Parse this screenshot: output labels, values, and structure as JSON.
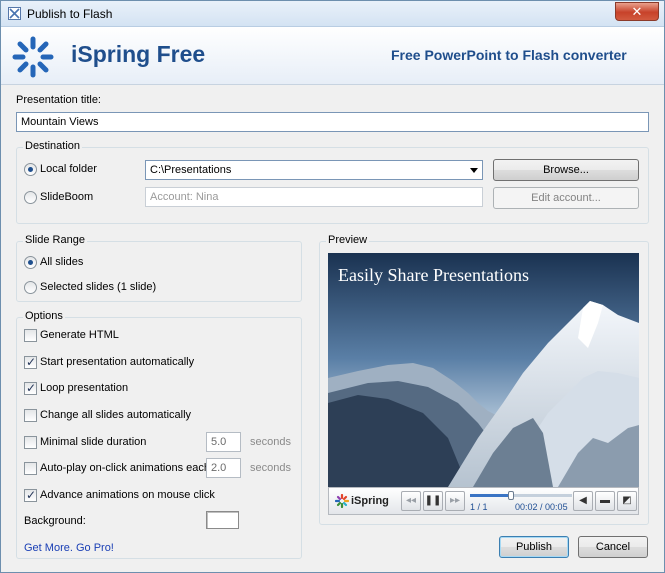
{
  "window": {
    "title": "Publish to Flash"
  },
  "banner": {
    "brand": "iSpring Free",
    "tagline": "Free PowerPoint to Flash converter"
  },
  "presentation": {
    "title_label": "Presentation title:",
    "title_value": "Mountain Views"
  },
  "destination": {
    "group_label": "Destination",
    "local_folder_label": "Local folder",
    "local_folder_value": "C:\\Presentations",
    "browse_label": "Browse...",
    "slideboom_label": "SlideBoom",
    "account_placeholder": "Account: Nina",
    "edit_account_label": "Edit account..."
  },
  "slide_range": {
    "group_label": "Slide Range",
    "all_slides_label": "All slides",
    "selected_slides_label": "Selected slides (1 slide)"
  },
  "options": {
    "group_label": "Options",
    "generate_html": {
      "label": "Generate HTML",
      "checked": false
    },
    "start_auto": {
      "label": "Start presentation automatically",
      "checked": true
    },
    "loop": {
      "label": "Loop presentation",
      "checked": true
    },
    "change_all": {
      "label": "Change all slides automatically",
      "checked": false
    },
    "min_duration": {
      "label": "Minimal slide duration",
      "value": "5.0",
      "units": "seconds",
      "checked": false
    },
    "autoplay": {
      "label": "Auto-play on-click animations each",
      "value": "2.0",
      "units": "seconds",
      "checked": false
    },
    "advance": {
      "label": "Advance animations on mouse click",
      "checked": true
    },
    "background_label": "Background:",
    "pro_link": "Get More. Go Pro!"
  },
  "preview": {
    "group_label": "Preview",
    "slide_title": "Easily Share Presentations",
    "player_brand": "iSpring",
    "slide_counter": "1 / 1",
    "time_current": "00:02",
    "time_separator": " / ",
    "time_total": "00:05",
    "progress_fraction": 0.4
  },
  "footer": {
    "publish_label": "Publish",
    "cancel_label": "Cancel"
  },
  "colors": {
    "brand": "#1f4e8c",
    "link": "#1a3fb5",
    "accent": "#3a74c4"
  }
}
